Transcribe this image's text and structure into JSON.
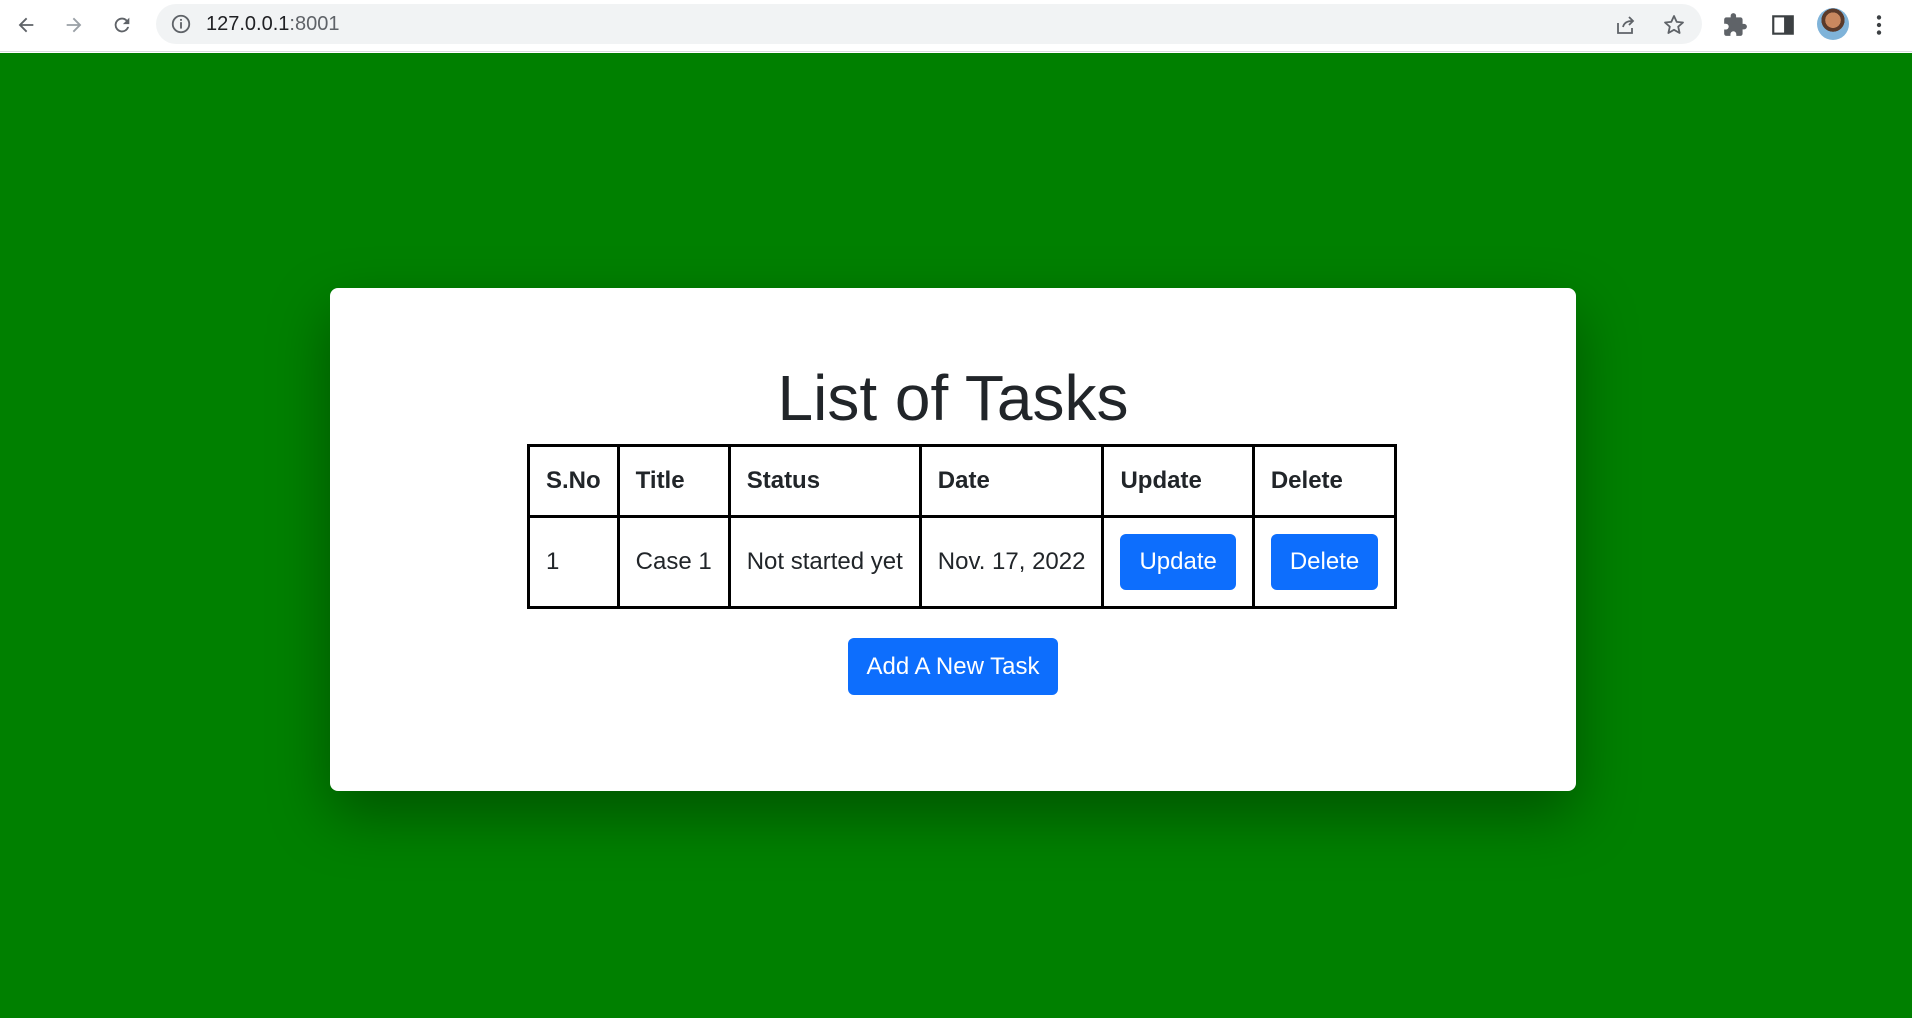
{
  "browser": {
    "url_host": "127.0.0.1",
    "url_port": ":8001",
    "icons": {
      "back": "back-arrow-icon",
      "forward": "forward-arrow-icon",
      "reload": "reload-icon",
      "site_info": "info-icon",
      "share": "share-icon",
      "bookmark": "star-icon",
      "extensions": "puzzle-icon",
      "side_panel": "side-panel-icon",
      "profile": "avatar",
      "menu": "kebab-menu-icon"
    }
  },
  "page": {
    "background_color": "#008000",
    "title": "List of Tasks",
    "table": {
      "headers": [
        "S.No",
        "Title",
        "Status",
        "Date",
        "Update",
        "Delete"
      ],
      "rows": [
        {
          "sno": "1",
          "title": "Case 1",
          "status": "Not started yet",
          "date": "Nov. 17, 2022",
          "update_label": "Update",
          "delete_label": "Delete"
        }
      ]
    },
    "add_button_label": "Add A New Task",
    "button_color": "#0d6efd"
  }
}
